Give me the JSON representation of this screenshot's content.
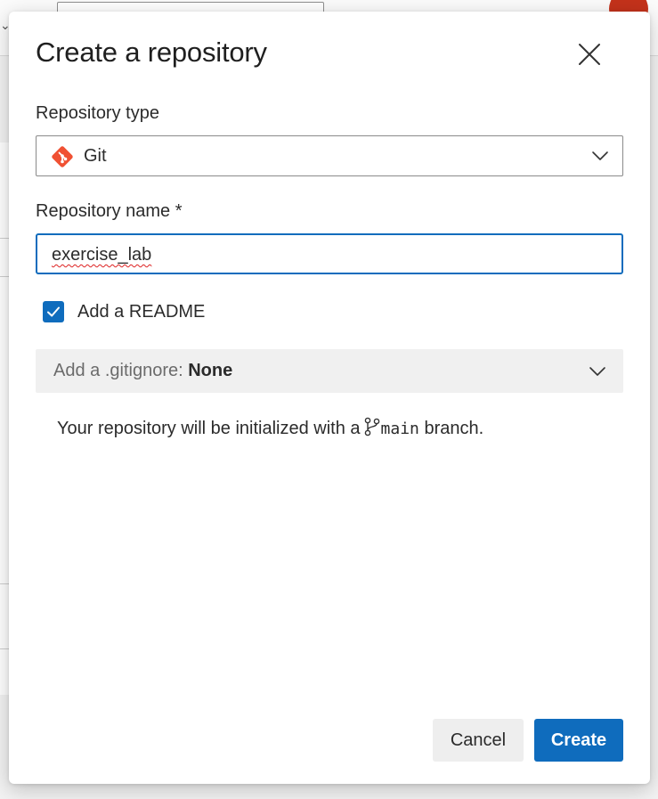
{
  "dialog": {
    "title": "Create a repository",
    "close_icon": "close-icon"
  },
  "repo_type": {
    "label": "Repository type",
    "value": "Git",
    "icon": "git-icon",
    "icon_color": "#f05133"
  },
  "repo_name": {
    "label": "Repository name *",
    "value": "exercise_lab"
  },
  "readme": {
    "label": "Add a README",
    "checked": true
  },
  "gitignore": {
    "prefix": "Add a .gitignore:",
    "value": "None"
  },
  "info": {
    "text_before": "Your repository will be initialized with a",
    "branch": "main",
    "text_after": "branch.",
    "icon": "branch-icon"
  },
  "buttons": {
    "cancel": "Cancel",
    "create": "Create"
  },
  "colors": {
    "accent": "#0f6cbd"
  }
}
